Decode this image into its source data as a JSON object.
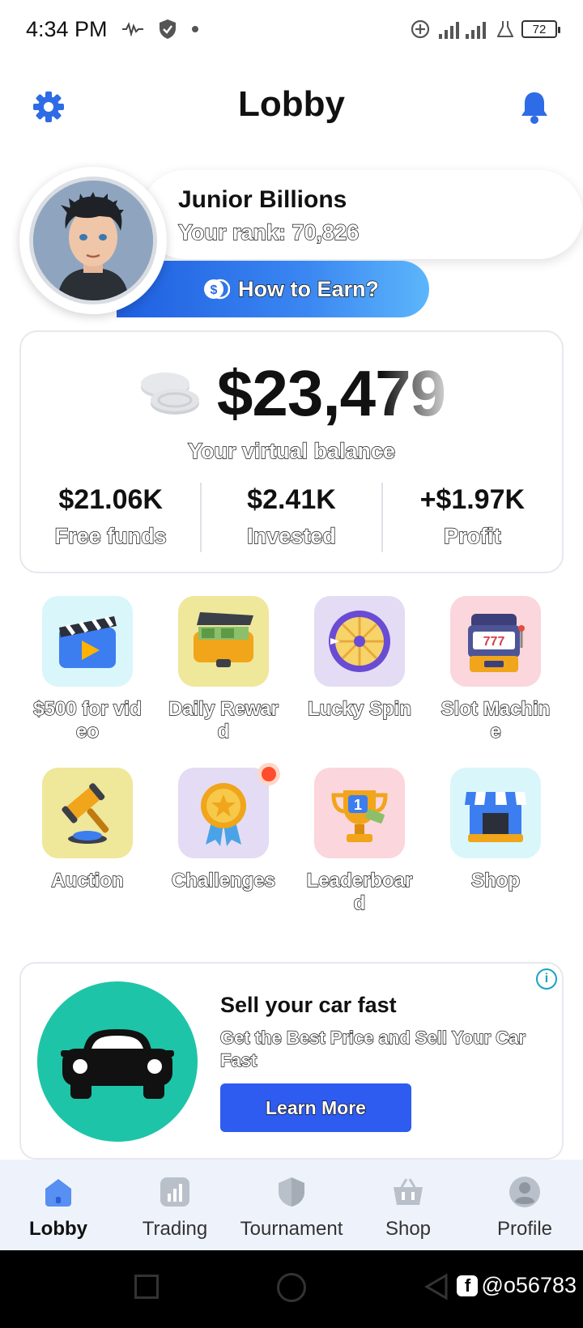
{
  "status_bar": {
    "time": "4:34 PM",
    "battery": "72"
  },
  "header": {
    "title": "Lobby"
  },
  "profile": {
    "name": "Junior Billions",
    "rank": "Your rank: 70,826",
    "earn_label": "How to Earn?"
  },
  "balance": {
    "amount": "$23,479",
    "caption": "Your virtual balance",
    "stats": [
      {
        "value": "$21.06K",
        "label": "Free funds"
      },
      {
        "value": "$2.41K",
        "label": "Invested"
      },
      {
        "value": "+$1.97K",
        "label": "Profit"
      }
    ]
  },
  "features": [
    {
      "label": "$500 for video",
      "icon": "clapperboard-icon",
      "bg": "#d9f6fb"
    },
    {
      "label": "Daily Reward",
      "icon": "money-case-icon",
      "bg": "#efe79a"
    },
    {
      "label": "Lucky Spin",
      "icon": "wheel-icon",
      "bg": "#e3dcf4"
    },
    {
      "label": "Slot Machine",
      "icon": "slot-machine-icon",
      "bg": "#fbd6dc"
    },
    {
      "label": "Auction",
      "icon": "gavel-icon",
      "bg": "#efe79a"
    },
    {
      "label": "Challenges",
      "icon": "medal-icon",
      "bg": "#e3dcf4"
    },
    {
      "label": "Leaderboard",
      "icon": "trophy-icon",
      "bg": "#fbd6dc"
    },
    {
      "label": "Shop",
      "icon": "store-icon",
      "bg": "#d9f6fb"
    }
  ],
  "ad": {
    "title": "Sell your car fast",
    "description": "Get the Best Price and Sell Your Car Fast",
    "button": "Learn More"
  },
  "bottom_nav": [
    {
      "label": "Lobby",
      "icon": "home-icon",
      "active": true
    },
    {
      "label": "Trading",
      "icon": "chart-icon",
      "active": false
    },
    {
      "label": "Tournament",
      "icon": "shield-icon",
      "active": false
    },
    {
      "label": "Shop",
      "icon": "basket-icon",
      "active": false
    },
    {
      "label": "Profile",
      "icon": "user-icon",
      "active": false
    }
  ],
  "watermark": "@o56783",
  "colors": {
    "accent_blue": "#2e6be6",
    "ad_button": "#2e5bf0",
    "ad_logo": "#1ec4a8",
    "nav_bg": "#eef3fb"
  }
}
